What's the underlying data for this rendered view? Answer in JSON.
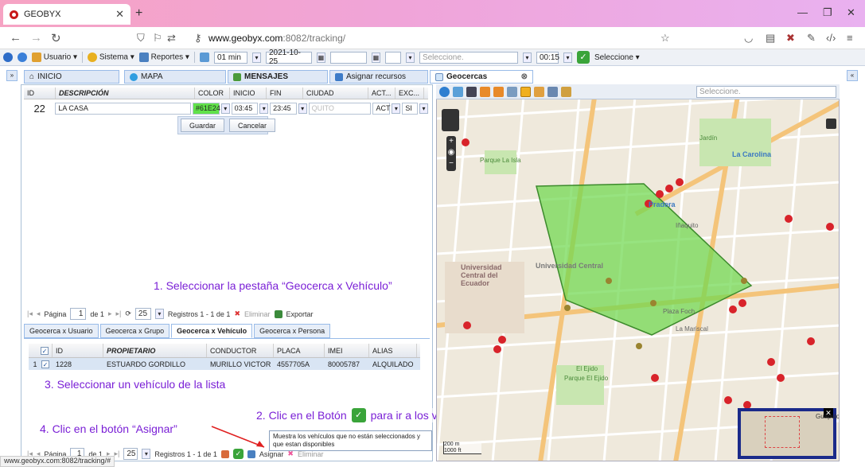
{
  "browser": {
    "tab_title": "GEOBYX",
    "url_host": "www.geobyx.com",
    "url_path": ":8082/tracking/",
    "status_url": "www.geobyx.com:8082/tracking/#"
  },
  "app_toolbar": {
    "usuario": "Usuario",
    "sistema": "Sistema",
    "reportes": "Reportes",
    "interval": "01 min",
    "date": "2021-10-25",
    "select_placeholder": "Seleccione.",
    "time": "00:15",
    "select2": "Seleccione"
  },
  "panel_tabs": {
    "inicio": "INICIO",
    "mapa": "MAPA",
    "mensajes": "MENSAJES",
    "asignar": "Asignar recursos",
    "geocercas": "Geocercas"
  },
  "geofence_grid": {
    "headers": [
      "ID",
      "DESCRIPCIÓN",
      "COLOR",
      "INICIO",
      "FIN",
      "CIUDAD",
      "ACT...",
      "EXC..."
    ],
    "row": {
      "id": "22",
      "descripcion": "LA CASA",
      "color": "#61E24",
      "inicio": "03:45",
      "fin": "23:45",
      "ciudad": "QUITO",
      "act": "ACT",
      "exc": "SI"
    },
    "save": "Guardar",
    "cancel": "Cancelar"
  },
  "pager1": {
    "pagina": "Página",
    "page": "1",
    "of": "de 1",
    "size": "25",
    "registros": "Registros 1 - 1 de 1",
    "eliminar": "Eliminar",
    "exportar": "Exportar"
  },
  "subtabs": [
    "Geocerca x Usuario",
    "Geocerca x Grupo",
    "Geocerca x Vehículo",
    "Geocerca x Persona"
  ],
  "vehicle_grid": {
    "headers": [
      "ID",
      "PROPIETARIO",
      "CONDUCTOR",
      "PLACA",
      "IMEI",
      "ALIAS"
    ],
    "row": {
      "num": "1",
      "id": "1228",
      "propietario": "ESTUARDO GORDILLO",
      "conductor": "MURILLO VICTOR",
      "placa": "4557705A",
      "imei": "80005787",
      "alias": "ALQUILADO"
    }
  },
  "pager2": {
    "pagina": "Página",
    "page": "1",
    "of": "de 1",
    "size": "25",
    "registros": "Registros 1 - 1 de 1",
    "asignar": "Asignar",
    "eliminar": "Eliminar"
  },
  "tooltip": "Muestra los vehículos que no están seleccionados y que estan disponibles",
  "annotations": {
    "a1": "1. Seleccionar la pestaña “Geocerca x Vehículo”",
    "a2a": "2. Clic en el Botón",
    "a2b": "para ir a los vehículos no seleccionados",
    "a3": "3. Seleccionar un vehículo de la lista",
    "a4": "4. Clic en el botón “Asignar”"
  },
  "map": {
    "select_placeholder": "Seleccione.",
    "labels": [
      "La Carolina",
      "Pradera",
      "Universidad Central",
      "Universidad Central del Ecuador",
      "Parque La Isla",
      "Plaza Foch",
      "La Mariscal",
      "El Ejido",
      "Parque El Ejido",
      "Guápulo",
      "Jardín",
      "Iñaquito"
    ],
    "scale_m": "200 m",
    "scale_ft": "1000 ft",
    "colors": {
      "zone": "#6fd84f",
      "zone_border": "#3c8a2c",
      "road": "#f4c47a",
      "pin": "#d8232a"
    }
  }
}
